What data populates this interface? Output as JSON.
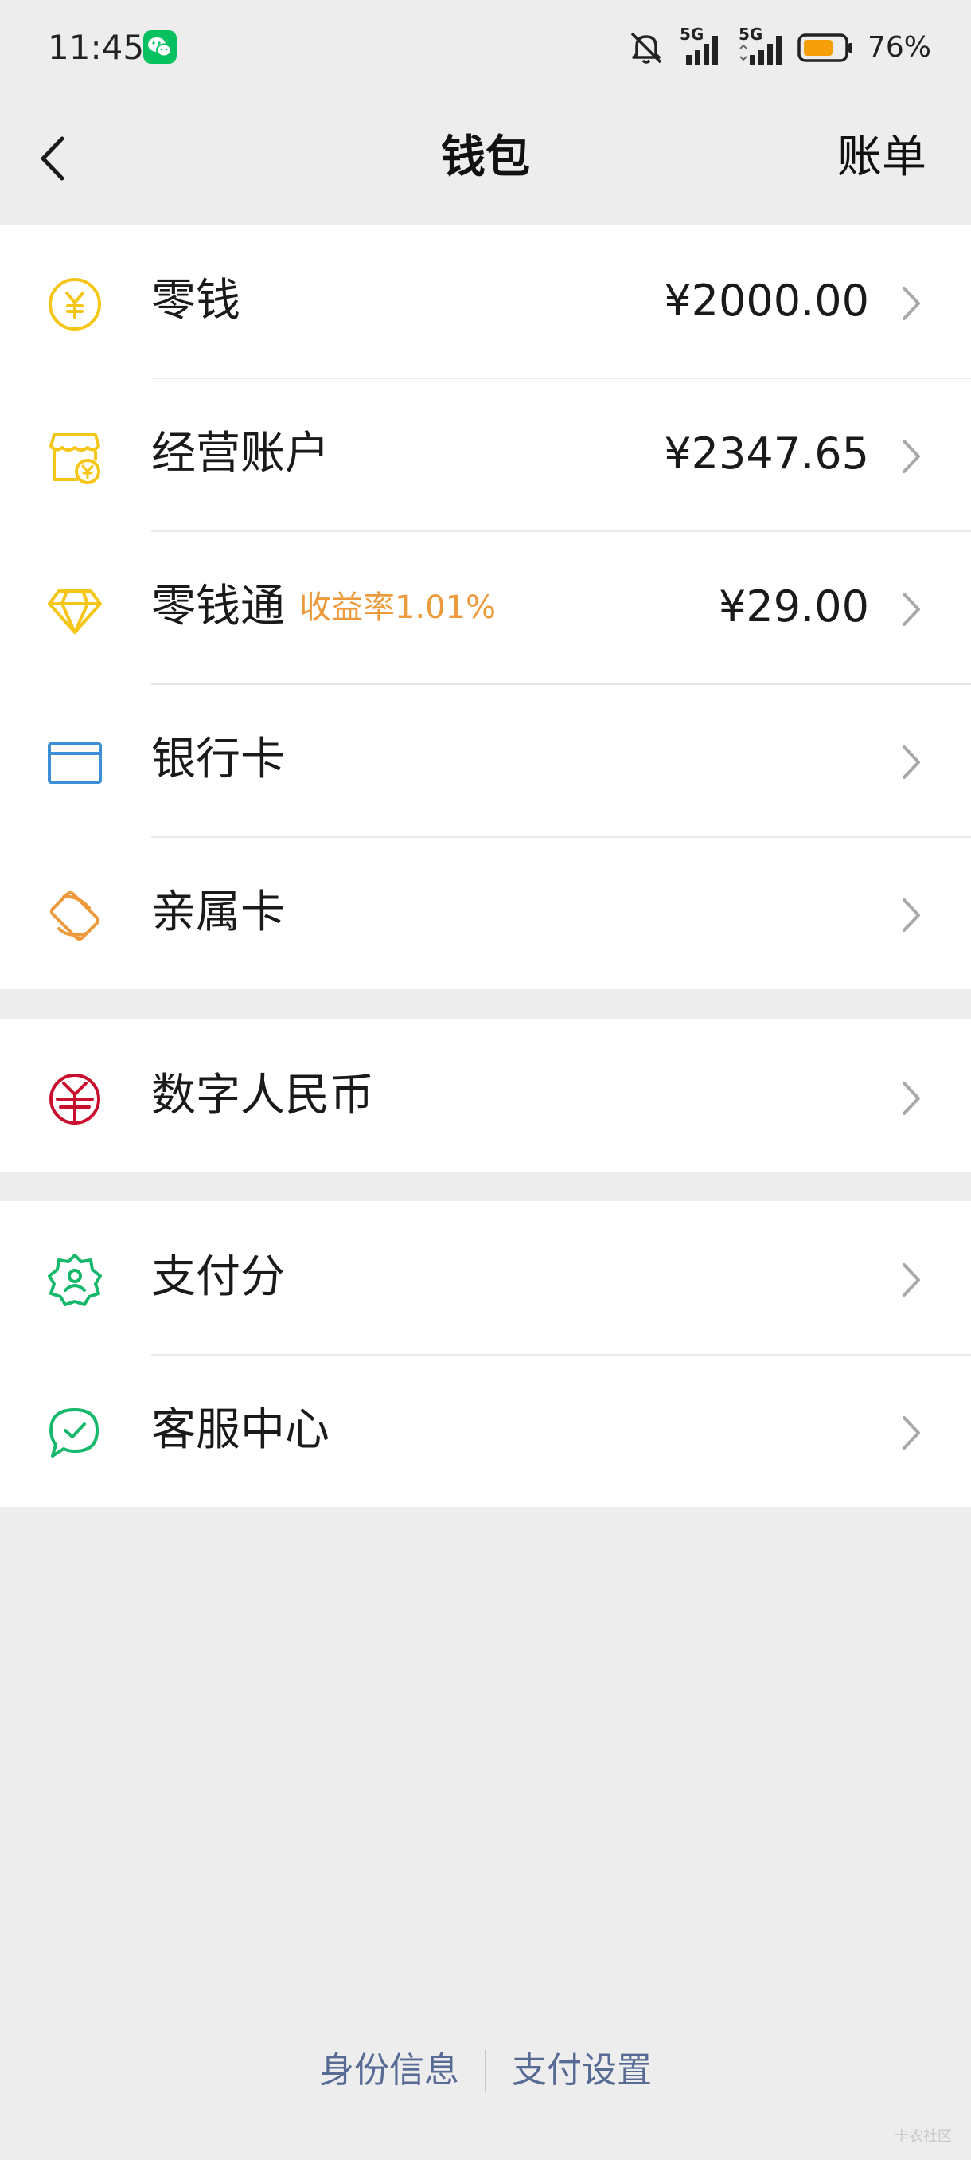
{
  "status_bar": {
    "time": "11:45",
    "network_1": "5G",
    "network_2": "5G",
    "battery": "76%",
    "notification_app_icon": "wechat-icon",
    "battery_level": 0.76
  },
  "nav": {
    "title": "钱包",
    "right_action": "账单",
    "back_icon": "chevron-left-icon"
  },
  "groups": [
    {
      "items": [
        {
          "label": "零钱",
          "value": "¥2000.00",
          "icon": "yuan-coin-icon",
          "icon_color": "#f5c518"
        },
        {
          "label": "经营账户",
          "value": "¥2347.65",
          "icon": "shop-account-icon",
          "icon_color": "#f5c518"
        },
        {
          "label": "零钱通",
          "tag": "收益率1.01%",
          "value": "¥29.00",
          "icon": "diamond-icon",
          "icon_color": "#f5c518"
        },
        {
          "label": "银行卡",
          "icon": "bank-card-icon",
          "icon_color": "#3f8fd8"
        },
        {
          "label": "亲属卡",
          "icon": "family-card-icon",
          "icon_color": "#ec9a3c"
        }
      ]
    },
    {
      "items": [
        {
          "label": "数字人民币",
          "icon": "digital-rmb-icon",
          "icon_color": "#c8102e"
        }
      ]
    },
    {
      "items": [
        {
          "label": "支付分",
          "icon": "pay-score-icon",
          "icon_color": "#16b86b"
        },
        {
          "label": "客服中心",
          "icon": "customer-service-icon",
          "icon_color": "#16b86b"
        }
      ]
    }
  ],
  "footer": {
    "link_1": "身份信息",
    "link_2": "支付设置"
  },
  "watermark": "卡农社区",
  "colors": {
    "page_bg": "#ededed",
    "card_bg": "#ffffff",
    "link_blue": "#576b95",
    "tag_orange": "#ec9a3c"
  }
}
